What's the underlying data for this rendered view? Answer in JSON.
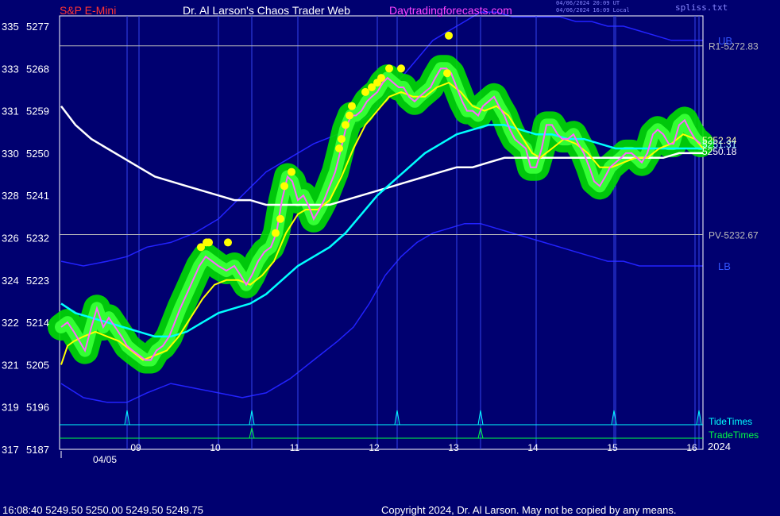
{
  "header": {
    "symbol": "S&P E-Mini",
    "title": "Dr. Al Larson's Chaos Trader Web",
    "site": "Daytradingforecasts.com",
    "timestamp_utc": "04/06/2024 20:09 UT",
    "timestamp_local": "04/06/2024 16:09 Local",
    "file": "spliss.txt"
  },
  "footer": {
    "quote": "16:08:40  5249.50 5250.00 5249.50 5249.75",
    "copyright": "Copyright 2024, Dr. Al Larson. May not be copied by any means."
  },
  "colors": {
    "background": "#000070",
    "price": "#ff66ff",
    "envelope": "#00dd00",
    "fast_ma": "#ffff00",
    "mid_ma": "#00ffff",
    "slow_ma": "#ffffff",
    "band": "#2222ff",
    "marker": "#ffff00",
    "tide": "#00ffff",
    "trade": "#00ff44"
  },
  "chart_data": {
    "type": "line",
    "x_labels": [
      "09",
      "10",
      "11",
      "12",
      "13",
      "14",
      "15",
      "16"
    ],
    "date_label": "04/05",
    "year_label": "2024",
    "y_ticks": [
      {
        "left": "335",
        "right": "5277",
        "value": 5277
      },
      {
        "left": "333",
        "right": "5268",
        "value": 5268
      },
      {
        "left": "331",
        "right": "5259",
        "value": 5259
      },
      {
        "left": "330",
        "right": "5250",
        "value": 5250
      },
      {
        "left": "328",
        "right": "5241",
        "value": 5241
      },
      {
        "left": "326",
        "right": "5232",
        "value": 5232
      },
      {
        "left": "324",
        "right": "5223",
        "value": 5223
      },
      {
        "left": "322",
        "right": "5214",
        "value": 5214
      },
      {
        "left": "321",
        "right": "5205",
        "value": 5205
      },
      {
        "left": "319",
        "right": "5196",
        "value": 5196
      },
      {
        "left": "317",
        "right": "5187",
        "value": 5187
      }
    ],
    "ylim": [
      5187,
      5277
    ],
    "xlim": [
      8.0,
      16.1
    ],
    "levels": [
      {
        "label": "R1-5272.83",
        "value": 5272.83
      },
      {
        "label": "PV-5232.67",
        "value": 5232.67
      }
    ],
    "band_labels": {
      "upper": "UB",
      "lower": "LB"
    },
    "last_values": [
      "5252.34",
      "5251.31",
      "5250.18"
    ],
    "legend": [
      "TideTimes",
      "TradeTimes"
    ],
    "tide_times": [
      8.85,
      10.42,
      12.25,
      13.3,
      14.98,
      16.05
    ],
    "trade_times": [
      10.42,
      13.3
    ],
    "price_series": [
      [
        8.02,
        5213
      ],
      [
        8.1,
        5214
      ],
      [
        8.18,
        5212
      ],
      [
        8.25,
        5210
      ],
      [
        8.32,
        5208
      ],
      [
        8.4,
        5213
      ],
      [
        8.47,
        5217
      ],
      [
        8.55,
        5213
      ],
      [
        8.62,
        5215
      ],
      [
        8.7,
        5213
      ],
      [
        8.78,
        5211
      ],
      [
        8.85,
        5209
      ],
      [
        8.92,
        5208
      ],
      [
        9.0,
        5207
      ],
      [
        9.08,
        5206
      ],
      [
        9.15,
        5206
      ],
      [
        9.22,
        5208
      ],
      [
        9.3,
        5209
      ],
      [
        9.38,
        5211
      ],
      [
        9.45,
        5214
      ],
      [
        9.52,
        5217
      ],
      [
        9.6,
        5220
      ],
      [
        9.68,
        5223
      ],
      [
        9.76,
        5226
      ],
      [
        9.84,
        5228
      ],
      [
        9.92,
        5227
      ],
      [
        10.0,
        5226
      ],
      [
        10.1,
        5225
      ],
      [
        10.2,
        5226
      ],
      [
        10.28,
        5224
      ],
      [
        10.35,
        5222
      ],
      [
        10.42,
        5224
      ],
      [
        10.5,
        5227
      ],
      [
        10.58,
        5229
      ],
      [
        10.66,
        5230
      ],
      [
        10.73,
        5233
      ],
      [
        10.8,
        5240
      ],
      [
        10.87,
        5245
      ],
      [
        10.93,
        5244
      ],
      [
        11.0,
        5240
      ],
      [
        11.07,
        5241
      ],
      [
        11.13,
        5239
      ],
      [
        11.2,
        5236
      ],
      [
        11.27,
        5238
      ],
      [
        11.33,
        5240
      ],
      [
        11.4,
        5243
      ],
      [
        11.47,
        5246
      ],
      [
        11.53,
        5250
      ],
      [
        11.6,
        5255
      ],
      [
        11.67,
        5258
      ],
      [
        11.73,
        5258
      ],
      [
        11.8,
        5259
      ],
      [
        11.87,
        5261
      ],
      [
        11.93,
        5262
      ],
      [
        12.0,
        5263
      ],
      [
        12.07,
        5265
      ],
      [
        12.13,
        5266
      ],
      [
        12.2,
        5265
      ],
      [
        12.27,
        5264
      ],
      [
        12.33,
        5264
      ],
      [
        12.4,
        5262
      ],
      [
        12.47,
        5261
      ],
      [
        12.53,
        5262
      ],
      [
        12.6,
        5263
      ],
      [
        12.67,
        5264
      ],
      [
        12.73,
        5266
      ],
      [
        12.8,
        5268
      ],
      [
        12.87,
        5268
      ],
      [
        12.93,
        5267
      ],
      [
        13.0,
        5264
      ],
      [
        13.07,
        5261
      ],
      [
        13.13,
        5259
      ],
      [
        13.2,
        5259
      ],
      [
        13.27,
        5258
      ],
      [
        13.33,
        5260
      ],
      [
        13.4,
        5261
      ],
      [
        13.47,
        5262
      ],
      [
        13.53,
        5260
      ],
      [
        13.6,
        5258
      ],
      [
        13.67,
        5255
      ],
      [
        13.73,
        5253
      ],
      [
        13.8,
        5252
      ],
      [
        13.87,
        5251
      ],
      [
        13.93,
        5247
      ],
      [
        14.0,
        5247
      ],
      [
        14.07,
        5251
      ],
      [
        14.13,
        5256
      ],
      [
        14.2,
        5256
      ],
      [
        14.27,
        5254
      ],
      [
        14.33,
        5253
      ],
      [
        14.4,
        5253
      ],
      [
        14.47,
        5254
      ],
      [
        14.53,
        5252
      ],
      [
        14.6,
        5250
      ],
      [
        14.67,
        5247
      ],
      [
        14.73,
        5244
      ],
      [
        14.8,
        5243
      ],
      [
        14.87,
        5245
      ],
      [
        14.93,
        5247
      ],
      [
        15.0,
        5248
      ],
      [
        15.07,
        5249
      ],
      [
        15.13,
        5250
      ],
      [
        15.2,
        5250
      ],
      [
        15.27,
        5249
      ],
      [
        15.33,
        5248
      ],
      [
        15.4,
        5250
      ],
      [
        15.47,
        5254
      ],
      [
        15.53,
        5255
      ],
      [
        15.6,
        5254
      ],
      [
        15.67,
        5252
      ],
      [
        15.73,
        5252
      ],
      [
        15.8,
        5256
      ],
      [
        15.87,
        5257
      ],
      [
        15.93,
        5255
      ],
      [
        16.0,
        5253
      ],
      [
        16.07,
        5252
      ]
    ],
    "fast_ma": [
      [
        8.02,
        5205
      ],
      [
        8.1,
        5209
      ],
      [
        8.18,
        5210
      ],
      [
        8.3,
        5211
      ],
      [
        8.45,
        5212
      ],
      [
        8.6,
        5211
      ],
      [
        8.75,
        5210
      ],
      [
        8.9,
        5208
      ],
      [
        9.05,
        5206
      ],
      [
        9.2,
        5207
      ],
      [
        9.35,
        5208
      ],
      [
        9.5,
        5211
      ],
      [
        9.65,
        5215
      ],
      [
        9.8,
        5219
      ],
      [
        9.95,
        5222
      ],
      [
        10.1,
        5223
      ],
      [
        10.25,
        5223
      ],
      [
        10.4,
        5222
      ],
      [
        10.55,
        5224
      ],
      [
        10.7,
        5227
      ],
      [
        10.85,
        5233
      ],
      [
        11.0,
        5237
      ],
      [
        11.1,
        5238
      ],
      [
        11.25,
        5238
      ],
      [
        11.4,
        5240
      ],
      [
        11.55,
        5245
      ],
      [
        11.7,
        5251
      ],
      [
        11.85,
        5256
      ],
      [
        12.0,
        5259
      ],
      [
        12.15,
        5262
      ],
      [
        12.3,
        5263
      ],
      [
        12.45,
        5262
      ],
      [
        12.6,
        5262
      ],
      [
        12.75,
        5264
      ],
      [
        12.9,
        5265
      ],
      [
        13.05,
        5263
      ],
      [
        13.2,
        5260
      ],
      [
        13.35,
        5259
      ],
      [
        13.5,
        5260
      ],
      [
        13.65,
        5258
      ],
      [
        13.8,
        5254
      ],
      [
        13.95,
        5250
      ],
      [
        14.05,
        5249
      ],
      [
        14.2,
        5251
      ],
      [
        14.35,
        5253
      ],
      [
        14.5,
        5252
      ],
      [
        14.65,
        5250
      ],
      [
        14.8,
        5247
      ],
      [
        14.95,
        5247
      ],
      [
        15.1,
        5248
      ],
      [
        15.25,
        5249
      ],
      [
        15.4,
        5249
      ],
      [
        15.55,
        5251
      ],
      [
        15.7,
        5252
      ],
      [
        15.85,
        5254
      ],
      [
        16.0,
        5253
      ],
      [
        16.1,
        5251
      ]
    ],
    "mid_ma": [
      [
        8.02,
        5218
      ],
      [
        8.2,
        5216
      ],
      [
        8.4,
        5215
      ],
      [
        8.6,
        5214
      ],
      [
        8.8,
        5213
      ],
      [
        9.0,
        5212
      ],
      [
        9.2,
        5211
      ],
      [
        9.4,
        5211
      ],
      [
        9.6,
        5212
      ],
      [
        9.8,
        5214
      ],
      [
        10.0,
        5216
      ],
      [
        10.2,
        5217
      ],
      [
        10.4,
        5218
      ],
      [
        10.6,
        5220
      ],
      [
        10.8,
        5223
      ],
      [
        11.0,
        5226
      ],
      [
        11.2,
        5228
      ],
      [
        11.4,
        5230
      ],
      [
        11.6,
        5233
      ],
      [
        11.8,
        5237
      ],
      [
        12.0,
        5241
      ],
      [
        12.2,
        5244
      ],
      [
        12.4,
        5247
      ],
      [
        12.6,
        5250
      ],
      [
        12.8,
        5252
      ],
      [
        13.0,
        5254
      ],
      [
        13.2,
        5255
      ],
      [
        13.4,
        5256
      ],
      [
        13.6,
        5256
      ],
      [
        13.8,
        5255
      ],
      [
        14.0,
        5254
      ],
      [
        14.2,
        5254
      ],
      [
        14.4,
        5253
      ],
      [
        14.6,
        5253
      ],
      [
        14.8,
        5252
      ],
      [
        15.0,
        5251
      ],
      [
        15.2,
        5251
      ],
      [
        15.4,
        5251
      ],
      [
        15.6,
        5251
      ],
      [
        15.8,
        5251
      ],
      [
        16.0,
        5251
      ],
      [
        16.1,
        5251
      ]
    ],
    "slow_ma": [
      [
        8.02,
        5260
      ],
      [
        8.2,
        5256
      ],
      [
        8.4,
        5253
      ],
      [
        8.6,
        5251
      ],
      [
        8.8,
        5249
      ],
      [
        9.0,
        5247
      ],
      [
        9.2,
        5245
      ],
      [
        9.4,
        5244
      ],
      [
        9.6,
        5243
      ],
      [
        9.8,
        5242
      ],
      [
        10.0,
        5241
      ],
      [
        10.2,
        5240
      ],
      [
        10.4,
        5240
      ],
      [
        10.6,
        5239
      ],
      [
        10.8,
        5239
      ],
      [
        11.0,
        5239
      ],
      [
        11.2,
        5239
      ],
      [
        11.4,
        5239
      ],
      [
        11.6,
        5240
      ],
      [
        11.8,
        5241
      ],
      [
        12.0,
        5242
      ],
      [
        12.2,
        5243
      ],
      [
        12.4,
        5244
      ],
      [
        12.6,
        5245
      ],
      [
        12.8,
        5246
      ],
      [
        13.0,
        5247
      ],
      [
        13.2,
        5247
      ],
      [
        13.4,
        5248
      ],
      [
        13.6,
        5249
      ],
      [
        13.8,
        5249
      ],
      [
        14.0,
        5249
      ],
      [
        14.2,
        5249
      ],
      [
        14.4,
        5249
      ],
      [
        14.6,
        5249
      ],
      [
        14.8,
        5249
      ],
      [
        15.0,
        5249
      ],
      [
        15.2,
        5249
      ],
      [
        15.4,
        5249
      ],
      [
        15.6,
        5249
      ],
      [
        15.8,
        5250
      ],
      [
        16.0,
        5250
      ],
      [
        16.1,
        5250
      ]
    ],
    "upper_band": [
      [
        8.02,
        5227
      ],
      [
        8.3,
        5226
      ],
      [
        8.6,
        5227
      ],
      [
        8.85,
        5228
      ],
      [
        9.1,
        5230
      ],
      [
        9.4,
        5231
      ],
      [
        9.7,
        5233
      ],
      [
        10.0,
        5236
      ],
      [
        10.3,
        5241
      ],
      [
        10.6,
        5246
      ],
      [
        10.9,
        5249
      ],
      [
        11.2,
        5252
      ],
      [
        11.5,
        5254
      ],
      [
        11.7,
        5256
      ],
      [
        11.9,
        5258
      ],
      [
        12.1,
        5262
      ],
      [
        12.3,
        5266
      ],
      [
        12.5,
        5270
      ],
      [
        12.7,
        5274
      ],
      [
        12.9,
        5276
      ],
      [
        13.1,
        5278
      ],
      [
        13.3,
        5280
      ],
      [
        13.5,
        5280
      ],
      [
        13.7,
        5279
      ],
      [
        13.9,
        5279
      ],
      [
        14.1,
        5279
      ],
      [
        14.3,
        5279
      ],
      [
        14.5,
        5278
      ],
      [
        14.7,
        5278
      ],
      [
        14.9,
        5277
      ],
      [
        15.1,
        5277
      ],
      [
        15.3,
        5276
      ],
      [
        15.5,
        5275
      ],
      [
        15.7,
        5274
      ],
      [
        15.9,
        5274
      ],
      [
        16.1,
        5274
      ]
    ],
    "lower_band": [
      [
        8.02,
        5201
      ],
      [
        8.3,
        5198
      ],
      [
        8.6,
        5197
      ],
      [
        8.85,
        5197
      ],
      [
        9.1,
        5199
      ],
      [
        9.4,
        5201
      ],
      [
        9.7,
        5200
      ],
      [
        10.0,
        5199
      ],
      [
        10.3,
        5198
      ],
      [
        10.6,
        5199
      ],
      [
        10.9,
        5202
      ],
      [
        11.2,
        5206
      ],
      [
        11.5,
        5210
      ],
      [
        11.7,
        5213
      ],
      [
        11.9,
        5218
      ],
      [
        12.1,
        5224
      ],
      [
        12.3,
        5228
      ],
      [
        12.5,
        5231
      ],
      [
        12.7,
        5233
      ],
      [
        12.9,
        5234
      ],
      [
        13.1,
        5235
      ],
      [
        13.3,
        5235
      ],
      [
        13.5,
        5234
      ],
      [
        13.7,
        5233
      ],
      [
        13.9,
        5232
      ],
      [
        14.1,
        5231
      ],
      [
        14.3,
        5230
      ],
      [
        14.5,
        5229
      ],
      [
        14.7,
        5228
      ],
      [
        14.9,
        5227
      ],
      [
        15.1,
        5227
      ],
      [
        15.3,
        5226
      ],
      [
        15.5,
        5226
      ],
      [
        15.7,
        5226
      ],
      [
        15.9,
        5226
      ],
      [
        16.1,
        5226
      ]
    ],
    "markers": [
      [
        9.78,
        5230
      ],
      [
        9.85,
        5231
      ],
      [
        9.88,
        5231
      ],
      [
        10.12,
        5231
      ],
      [
        10.72,
        5233
      ],
      [
        10.78,
        5236
      ],
      [
        10.83,
        5243
      ],
      [
        10.92,
        5246
      ],
      [
        11.52,
        5251
      ],
      [
        11.55,
        5253
      ],
      [
        11.6,
        5256
      ],
      [
        11.65,
        5258
      ],
      [
        11.68,
        5260
      ],
      [
        11.85,
        5263
      ],
      [
        11.93,
        5264
      ],
      [
        12.0,
        5265
      ],
      [
        12.05,
        5266
      ],
      [
        12.15,
        5268
      ],
      [
        12.3,
        5268
      ],
      [
        12.88,
        5267
      ],
      [
        12.9,
        5275
      ]
    ]
  }
}
